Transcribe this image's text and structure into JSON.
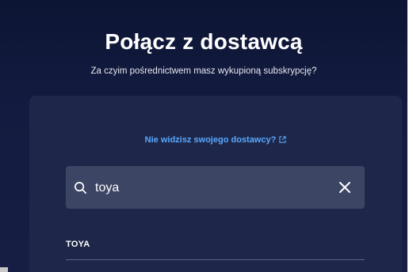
{
  "header": {
    "title": "Połącz z dostawcą",
    "subtitle": "Za czyim pośrednictwem masz wykupioną subskrypcję?"
  },
  "card": {
    "provider_link": "Nie widzisz swojego dostawcy?",
    "search": {
      "value": "toya",
      "placeholder": ""
    },
    "results": [
      {
        "label": "TOYA"
      }
    ]
  },
  "icons": {
    "search": "search-icon",
    "clear": "close-icon",
    "external": "external-link-icon"
  },
  "colors": {
    "background": "#131b40",
    "card": "#1e2749",
    "search_field": "#3c4564",
    "link": "#5aa8ff",
    "text": "#ffffff"
  }
}
